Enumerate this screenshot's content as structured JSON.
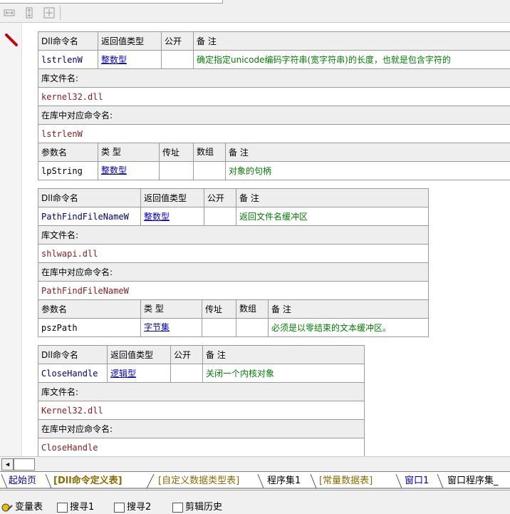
{
  "toolbar": {
    "icons": [
      "collapse-horizontal-icon",
      "collapse-vertical-icon",
      "expand-all-icon"
    ]
  },
  "dll_commands": [
    {
      "header": {
        "name": "Dll命令名",
        "return_type": "返回值类型",
        "public": "公开",
        "remark": "备 注"
      },
      "name": "lstrlenW",
      "return_type": "整数型",
      "public": "",
      "remark": "确定指定unicode编码字符串(宽字符串)的长度，也就是包含字符的",
      "lib_label": "库文件名:",
      "lib": "kernel32.dll",
      "entry_label": "在库中对应命令名:",
      "entry": "lstrlenW",
      "param_header": {
        "name": "参数名",
        "type": "类 型",
        "byref": "传址",
        "array": "数组",
        "remark": "备 注"
      },
      "params": [
        {
          "name": "lpString",
          "type": "整数型",
          "byref": "",
          "array": "",
          "remark": "对象的句柄"
        }
      ]
    },
    {
      "header": {
        "name": "Dll命令名",
        "return_type": "返回值类型",
        "public": "公开",
        "remark": "备 注"
      },
      "name": "PathFindFileNameW",
      "return_type": "整数型",
      "public": "",
      "remark": "返回文件名缓冲区",
      "lib_label": "库文件名:",
      "lib": "shlwapi.dll",
      "entry_label": "在库中对应命令名:",
      "entry": "PathFindFileNameW",
      "param_header": {
        "name": "参数名",
        "type": "类 型",
        "byref": "传址",
        "array": "数组",
        "remark": "备 注"
      },
      "params": [
        {
          "name": "pszPath",
          "type": "字节集",
          "byref": "",
          "array": "",
          "remark": "必须是以零结束的文本缓冲区。"
        }
      ]
    },
    {
      "header": {
        "name": "Dll命令名",
        "return_type": "返回值类型",
        "public": "公开",
        "remark": "备 注"
      },
      "name": "CloseHandle",
      "return_type": "逻辑型",
      "public": "",
      "remark": "关闭一个内核对象",
      "lib_label": "库文件名:",
      "lib": "Kernel32.dll",
      "entry_label": "在库中对应命令名:",
      "entry": "CloseHandle"
    }
  ],
  "tabs": [
    {
      "label": "起始页",
      "color": "#0000cc"
    },
    {
      "label": "[Dll命令定义表]",
      "color": "#8b6b00"
    },
    {
      "label": "[自定义数据类型表]",
      "color": "#8b6b00"
    },
    {
      "label": "程序集1",
      "color": "#000000"
    },
    {
      "label": "[常量数据表]",
      "color": "#8b6b00"
    },
    {
      "label": "窗口1",
      "color": "#0000cc"
    },
    {
      "label": "窗口程序集_",
      "color": "#000000"
    }
  ],
  "bottom_tabs": [
    {
      "label": "变量表",
      "icon": "variable-table-icon"
    },
    {
      "label": "搜寻1",
      "icon": "search-result-icon"
    },
    {
      "label": "搜寻2",
      "icon": "search-result-icon"
    },
    {
      "label": "剪辑历史",
      "icon": "clipboard-history-icon"
    }
  ],
  "colors": {
    "name": "#000080",
    "library": "#8b1a1a",
    "type_link": "#0000cc",
    "remark": "#008000",
    "header_bg": "#eeeeee"
  }
}
